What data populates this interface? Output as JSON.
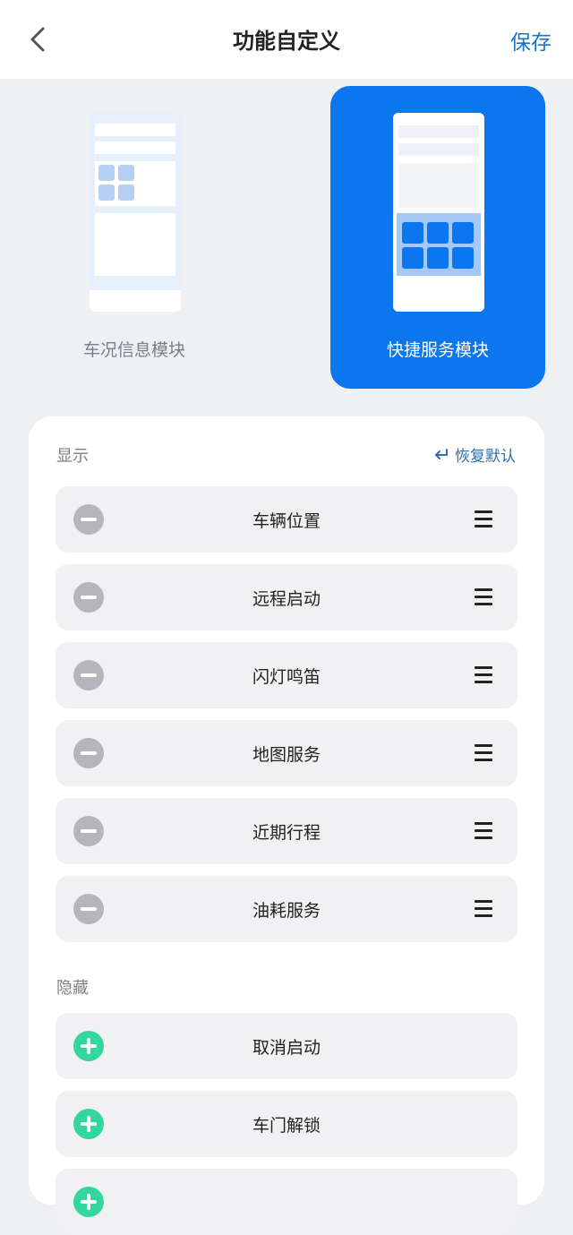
{
  "header": {
    "title": "功能自定义",
    "save_label": "保存",
    "back_icon": "chevron-left-icon"
  },
  "modules": [
    {
      "label": "车况信息模块",
      "selected": false
    },
    {
      "label": "快捷服务模块",
      "selected": true
    }
  ],
  "visible_section": {
    "title": "显示",
    "restore_label": "恢复默认",
    "restore_icon": "return-arrow-icon",
    "items": [
      "车辆位置",
      "远程启动",
      "闪灯鸣笛",
      "地图服务",
      "近期行程",
      "油耗服务"
    ]
  },
  "hidden_section": {
    "title": "隐藏",
    "items": [
      "取消启动",
      "车门解锁",
      ""
    ]
  },
  "colors": {
    "accent": "#0b76ee",
    "save_text": "#1a73c9",
    "remove": "#b4b6bb",
    "add": "#34d6a0"
  }
}
